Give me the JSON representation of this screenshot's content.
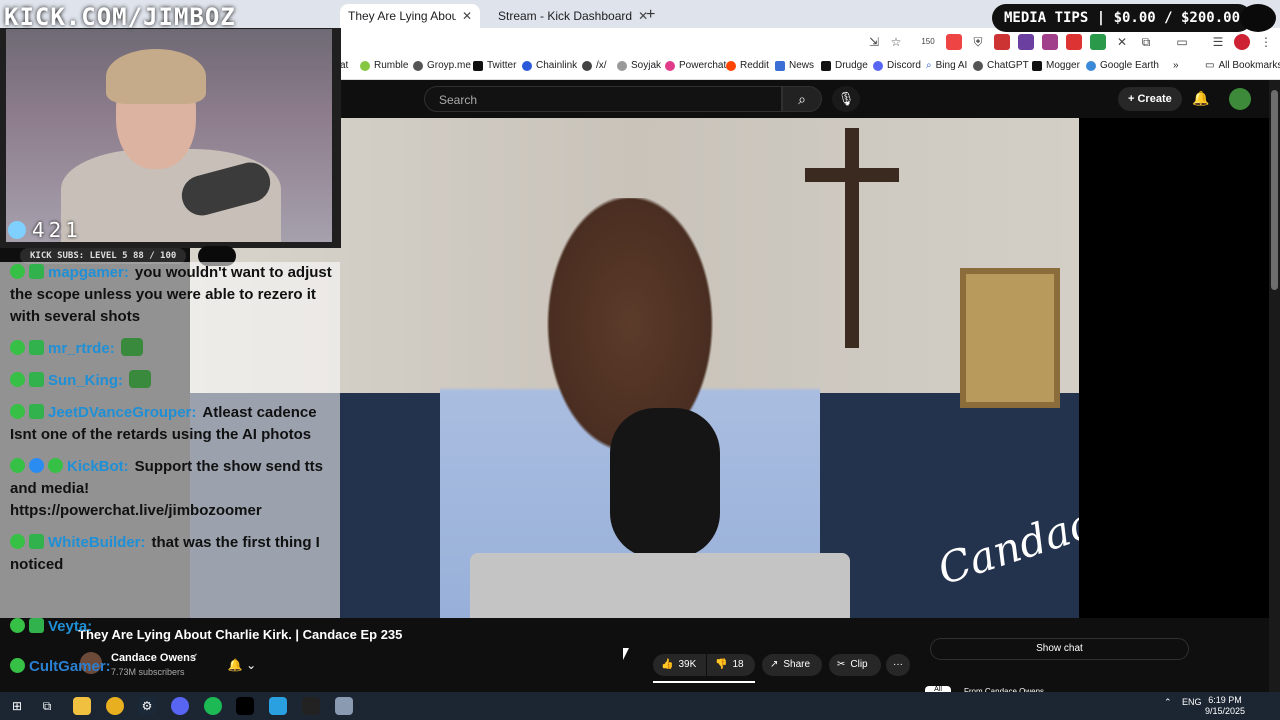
{
  "overlay": {
    "title": "KICK.COM/JIMBOZ",
    "media_tips": "MEDIA TIPS | $0.00 / $200.00",
    "viewer_count": "421",
    "subs_label": "KICK SUBS: LEVEL 5 88 / 100"
  },
  "browser": {
    "tabs": [
      {
        "label": "They Are Lying About Char"
      },
      {
        "label": "Stream - Kick Dashboard"
      }
    ],
    "new_tab": "+",
    "extension_badge": "150",
    "bookmarks": [
      {
        "label": "at"
      },
      {
        "label": "Rumble"
      },
      {
        "label": "Groyp.me"
      },
      {
        "label": "Twitter"
      },
      {
        "label": "Chainlink"
      },
      {
        "label": "/x/"
      },
      {
        "label": "Soyjak"
      },
      {
        "label": "Powerchat"
      },
      {
        "label": "Reddit"
      },
      {
        "label": "News"
      },
      {
        "label": "Drudge"
      },
      {
        "label": "Discord"
      },
      {
        "label": "Bing AI"
      },
      {
        "label": "ChatGPT"
      },
      {
        "label": "Mogger"
      },
      {
        "label": "Google Earth"
      },
      {
        "label": "All Bookmarks"
      }
    ],
    "bookmark_more": "»"
  },
  "youtube": {
    "search_placeholder": "Search",
    "create_label": "Create",
    "video_signature": "Candace",
    "video_title": "They Are Lying About Charlie Kirk. | Candace Ep 235",
    "channel_name": "Candace Owens",
    "subscribers": "7.73M subscribers",
    "likes": "39K",
    "dislikes": "18",
    "share_label": "Share",
    "clip_label": "Clip",
    "more_label": "···",
    "show_chat": "Show chat",
    "chip_all": "All",
    "chip_from": "From Candace Owens"
  },
  "chat": {
    "messages": [
      {
        "user": "mapgamer:",
        "text": "you wouldn't want to adjust the scope unless you were able to rezero it with several shots"
      },
      {
        "user": "mr_rtrde:",
        "text": ""
      },
      {
        "user": "Sun_King:",
        "text": ""
      },
      {
        "user": "JeetDVanceGrouper:",
        "text": "Atleast cadence Isnt one of the retards using the AI photos"
      },
      {
        "user": "KickBot:",
        "text": "Support the show send tts and media! https://powerchat.live/jimbozoomer"
      },
      {
        "user": "WhiteBuilder:",
        "text": "that was the first thing I noticed"
      }
    ],
    "bottom_user": "Veyta:",
    "bottom_user2": "CultGamer:"
  },
  "taskbar": {
    "lang": "ENG",
    "time": "6:19 PM",
    "date": "9/15/2025"
  },
  "colors": {
    "kick_green": "#53fc18",
    "youtube_bg": "#0f0f0f",
    "chat_username": "#1f8fd6"
  }
}
